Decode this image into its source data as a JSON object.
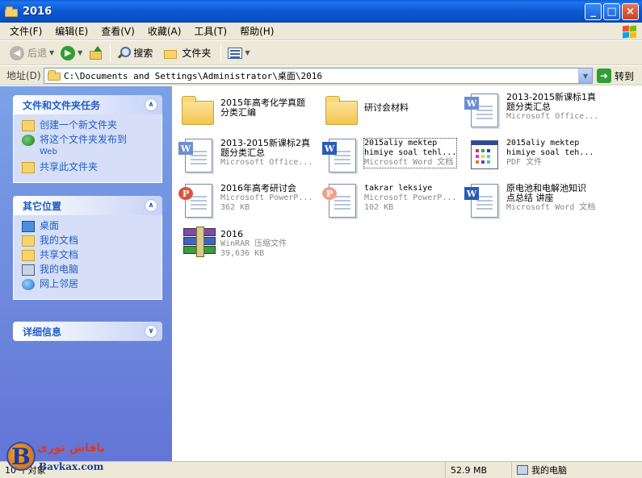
{
  "window": {
    "title": "2016",
    "icon": "folder-icon",
    "controls": [
      "_",
      "□",
      "×"
    ]
  },
  "menu": [
    "文件(F)",
    "编辑(E)",
    "查看(V)",
    "收藏(A)",
    "工具(T)",
    "帮助(H)"
  ],
  "toolbar": {
    "back_label": "后退",
    "search_label": "搜索",
    "folders_label": "文件夹"
  },
  "address": {
    "label": "地址(D)",
    "path": "C:\\Documents and Settings\\Administrator\\桌面\\2016",
    "go_label": "转到"
  },
  "sidebar": {
    "tasks": {
      "title": "文件和文件夹任务",
      "items": [
        {
          "label": "创建一个新文件夹",
          "icon": "new-folder-icon"
        },
        {
          "label": "将这个文件夹发布到",
          "sub": "Web",
          "icon": "publish-web-icon"
        },
        {
          "label": "共享此文件夹",
          "icon": "share-folder-icon"
        }
      ]
    },
    "places": {
      "title": "其它位置",
      "items": [
        {
          "label": "桌面",
          "icon": "desktop-icon"
        },
        {
          "label": "我的文档",
          "icon": "my-documents-icon"
        },
        {
          "label": "共享文档",
          "icon": "shared-documents-icon"
        },
        {
          "label": "我的电脑",
          "icon": "my-computer-icon"
        },
        {
          "label": "网上邻居",
          "icon": "network-places-icon"
        }
      ]
    },
    "details": {
      "title": "详细信息"
    }
  },
  "files": [
    {
      "name": "2015年高考化学真题",
      "name2": "分类汇编",
      "type": "",
      "size": "",
      "icon": "folder-icon"
    },
    {
      "name": "研讨会材料",
      "name2": "",
      "type": "",
      "size": "",
      "icon": "folder-icon"
    },
    {
      "name": "2013-2015新课标1真",
      "name2": "题分类汇总",
      "type": "Microsoft Office...",
      "size": "",
      "icon": "word-doc-icon"
    },
    {
      "name": "2013-2015新课标2真",
      "name2": "题分类汇总",
      "type": "Microsoft Office...",
      "size": "",
      "icon": "word-doc-icon"
    },
    {
      "name": "2015aliy mektep",
      "name2": "himiye soal tehl...",
      "type": "Microsoft Word 文档",
      "size": "",
      "icon": "word-doc-icon"
    },
    {
      "name": "2015aliy mektep",
      "name2": "himiye soal teh...",
      "type": "PDF 文件",
      "size": "",
      "icon": "pdf-icon"
    },
    {
      "name": "2016年高考研讨会",
      "name2": "",
      "type": "Microsoft PowerP...",
      "size": "362 KB",
      "icon": "powerpoint-icon"
    },
    {
      "name": "takrar leksiye",
      "name2": "",
      "type": "Microsoft PowerP...",
      "size": "102 KB",
      "icon": "powerpoint-icon"
    },
    {
      "name": "原电池和电解池知识",
      "name2": "点总结 讲座",
      "type": "Microsoft Word 文档",
      "size": "",
      "icon": "word-doc-icon"
    },
    {
      "name": "2016",
      "name2": "",
      "type": "WinRAR 压缩文件",
      "size": "39,636 KB",
      "icon": "winrar-icon"
    }
  ],
  "status": {
    "count": "10 个对象",
    "size": "52.9 MB",
    "zone": "我的电脑"
  },
  "watermark": {
    "fa": "باقاش توری",
    "en": "Bavkax.com"
  }
}
